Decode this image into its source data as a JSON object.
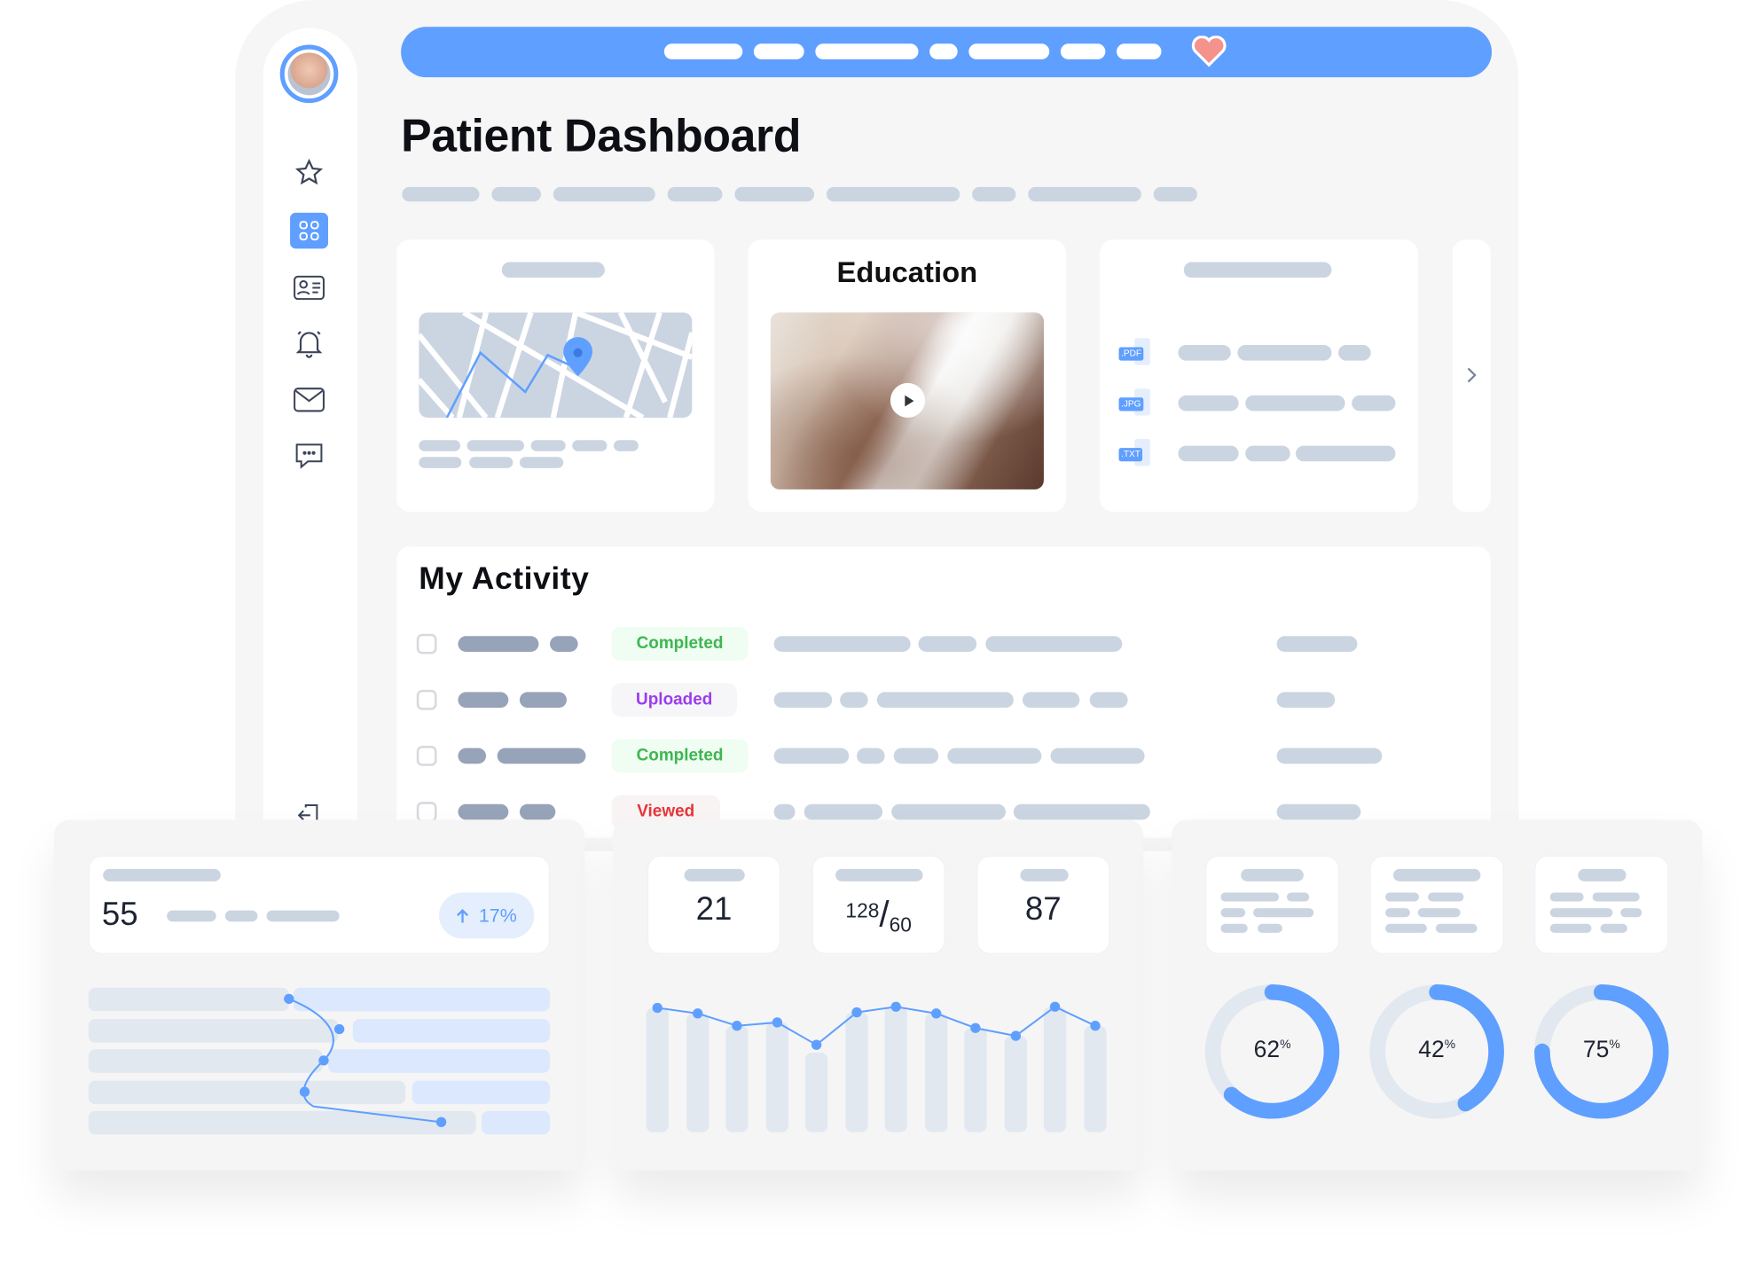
{
  "page": {
    "title": "Patient Dashboard"
  },
  "sidebar": {
    "items": [
      {
        "icon": "star-icon"
      },
      {
        "icon": "grid-icon",
        "active": true
      },
      {
        "icon": "contact-card-icon"
      },
      {
        "icon": "bell-icon"
      },
      {
        "icon": "mail-icon"
      },
      {
        "icon": "chat-icon"
      },
      {
        "icon": "logout-icon"
      }
    ]
  },
  "topbar": {
    "icon": "heart-icon",
    "color": "#5f9fff",
    "heart_color": "#f4928c"
  },
  "cards": {
    "education": {
      "title": "Education",
      "media": "video-thumbnail"
    },
    "files": [
      {
        "type": ".PDF"
      },
      {
        "type": ".JPG"
      },
      {
        "type": ".TXT"
      }
    ]
  },
  "activity": {
    "title": "My Activity",
    "rows": [
      {
        "status": "Completed",
        "color": "#3fb651",
        "bg": "#effdf2"
      },
      {
        "status": "Uploaded",
        "color": "#9a3cf0",
        "bg": "#f6f6f8"
      },
      {
        "status": "Completed",
        "color": "#3fb651",
        "bg": "#effdf2"
      },
      {
        "status": "Viewed",
        "color": "#e5363a",
        "bg": "#f8f4f4"
      }
    ]
  },
  "stats": {
    "main_value": "55",
    "trend": {
      "direction": "up",
      "value": "17%",
      "icon": "arrow-up-icon"
    },
    "vitals": [
      {
        "value": "21"
      },
      {
        "value": "128",
        "sub": "60"
      },
      {
        "value": "87"
      }
    ],
    "donuts": [
      {
        "value": "62",
        "unit": "%",
        "percent": 62
      },
      {
        "value": "42",
        "unit": "%",
        "percent": 42
      },
      {
        "value": "75",
        "unit": "%",
        "percent": 75
      }
    ]
  },
  "colors": {
    "accent": "#5f9fff",
    "placeholder": "#cbd5e1",
    "placeholder_dark": "#97a3b8"
  }
}
